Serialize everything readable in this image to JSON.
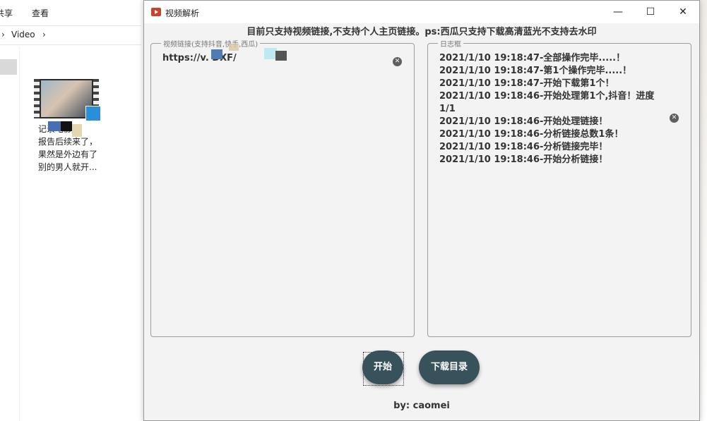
{
  "explorer": {
    "menu": [
      "共享",
      "查看"
    ],
    "breadcrumb": [
      "Video"
    ],
    "file": {
      "caption_lines": [
        "记录电影",
        "报告后续来了，",
        "果然是外边有了",
        "别的男人就开..."
      ]
    }
  },
  "window": {
    "title": "视频解析",
    "controls": {
      "minimize": "—",
      "maximize": "☐",
      "close": "✕"
    },
    "notice": "目前只支持视频链接,不支持个人主页链接。ps:西瓜只支持下载高清蓝光不支持去水印",
    "url_panel": {
      "legend": "视频链接(支持抖音,快手,西瓜)",
      "value": "https://v.                DXF/"
    },
    "log_panel": {
      "legend": "日志框",
      "lines": [
        "2021/1/10 19:18:47-全部操作完毕.....！",
        "2021/1/10 19:18:47-第1个操作完毕.....！",
        "2021/1/10 19:18:47-开始下载第1个！",
        "2021/1/10  19:18:46-开始处理第1个,抖音！进度 1/1",
        "2021/1/10 19:18:46-开始处理链接！",
        "2021/1/10 19:18:46-分析链接总数1条！",
        "2021/1/10 19:18:46-分析链接完毕！",
        "2021/1/10 19:18:46-开始分析链接！"
      ]
    },
    "buttons": {
      "start": "开始",
      "download_dir": "下载目录"
    },
    "footer": "by: caomei"
  },
  "colors": {
    "fab": "#37525a",
    "panel_border": "#9c9c9c",
    "window_bg": "#f3f3f3"
  }
}
